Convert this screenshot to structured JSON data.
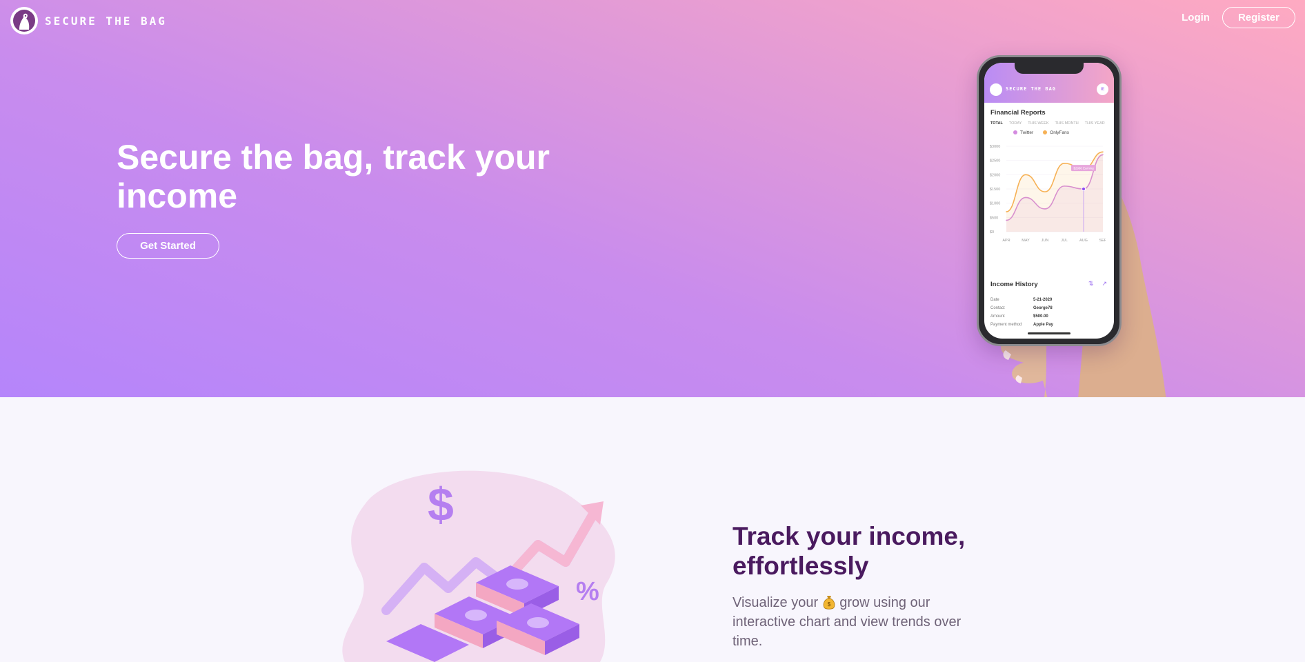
{
  "nav": {
    "brand": "SECURE THE BAG",
    "login": "Login",
    "register": "Register"
  },
  "hero": {
    "title": "Secure the bag, track your income",
    "cta": "Get Started"
  },
  "phone": {
    "app_brand": "SECURE THE BAG",
    "avatar": "IE",
    "reports_title": "Financial Reports",
    "tabs": [
      "TOTAL",
      "TODAY",
      "THIS WEEK",
      "THIS MONTH",
      "THIS YEAR"
    ],
    "legend": [
      {
        "name": "Twitter",
        "color": "#d48be0"
      },
      {
        "name": "OnlyFans",
        "color": "#f6b155"
      }
    ],
    "chart_data": {
      "type": "line",
      "categories": [
        "APR",
        "MAY",
        "JUN",
        "JUL",
        "AUG",
        "SEP"
      ],
      "y_ticks": [
        "$3000",
        "$2500",
        "$2000",
        "$1500",
        "$1000",
        "$500",
        "$0"
      ],
      "ylim": [
        0,
        3000
      ],
      "series": [
        {
          "name": "Twitter",
          "values": [
            400,
            1200,
            800,
            1600,
            1500,
            2700
          ]
        },
        {
          "name": "OnlyFans",
          "values": [
            700,
            2000,
            1400,
            2400,
            2200,
            2800
          ]
        }
      ],
      "tooltip": "$2980 Earning"
    },
    "history_title": "Income History",
    "history_rows": [
      {
        "label": "Date",
        "value": "5-21-2020"
      },
      {
        "label": "Contact",
        "value": "George78"
      },
      {
        "label": "Amount",
        "value": "$500.00"
      },
      {
        "label": "Payment method",
        "value": "Apple Pay"
      }
    ]
  },
  "feature": {
    "title": "Track your income, effortlessly",
    "text_before": "Visualize your",
    "text_after": "grow using our interactive chart and view trends over time."
  },
  "colors": {
    "hero_start": "#b585fb",
    "hero_end": "#ffaac1",
    "feature_title": "#4a1a5f",
    "feature_text": "#6f6378"
  }
}
